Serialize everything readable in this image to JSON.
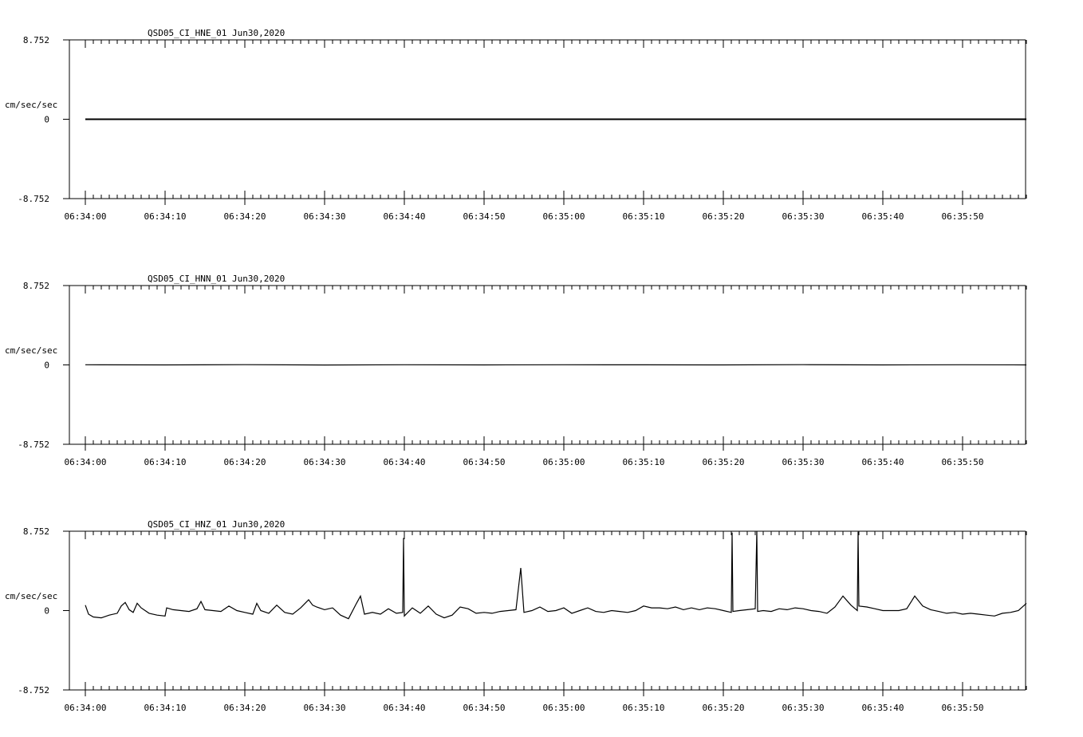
{
  "chart_data": [
    {
      "type": "line",
      "title": "QSD05_CI_HNE_01  Jun30,2020",
      "ylabel": "cm/sec/sec",
      "ylim": [
        -8.752,
        8.752
      ],
      "yticks": [
        "8.752",
        "0",
        "-8.752"
      ],
      "xlim_seconds": [
        0,
        118
      ],
      "xticks": [
        "06:34:00",
        "06:34:10",
        "06:34:20",
        "06:34:30",
        "06:34:40",
        "06:34:50",
        "06:35:00",
        "06:35:10",
        "06:35:20",
        "06:35:30",
        "06:35:40",
        "06:35:50"
      ],
      "series": [
        {
          "values": [
            [
              0,
              0
            ],
            [
              118,
              0
            ]
          ]
        }
      ],
      "grid": false
    },
    {
      "type": "line",
      "title": "QSD05_CI_HNN_01  Jun30,2020",
      "ylabel": "cm/sec/sec",
      "ylim": [
        -8.752,
        8.752
      ],
      "yticks": [
        "8.752",
        "0",
        "-8.752"
      ],
      "xlim_seconds": [
        0,
        118
      ],
      "xticks": [
        "06:34:00",
        "06:34:10",
        "06:34:20",
        "06:34:30",
        "06:34:40",
        "06:34:50",
        "06:35:00",
        "06:35:10",
        "06:35:20",
        "06:35:30",
        "06:35:40",
        "06:35:50"
      ],
      "series": [
        {
          "values": [
            [
              0,
              0.02
            ],
            [
              10,
              0.0
            ],
            [
              20,
              0.03
            ],
            [
              30,
              -0.01
            ],
            [
              40,
              0.02
            ],
            [
              50,
              0.0
            ],
            [
              60,
              0.02
            ],
            [
              70,
              0.01
            ],
            [
              80,
              0.0
            ],
            [
              90,
              0.03
            ],
            [
              100,
              0.0
            ],
            [
              110,
              0.02
            ],
            [
              118,
              0.0
            ]
          ]
        }
      ],
      "grid": false
    },
    {
      "type": "line",
      "title": "QSD05_CI_HNZ_01  Jun30,2020",
      "ylabel": "cm/sec/sec",
      "ylim": [
        -8.752,
        8.752
      ],
      "yticks": [
        "8.752",
        "0",
        "-8.752"
      ],
      "xlim_seconds": [
        0,
        118
      ],
      "xticks": [
        "06:34:00",
        "06:34:10",
        "06:34:20",
        "06:34:30",
        "06:34:40",
        "06:34:50",
        "06:35:00",
        "06:35:10",
        "06:35:20",
        "06:35:30",
        "06:35:40",
        "06:35:50"
      ],
      "series": [
        {
          "values": [
            [
              0,
              0.6
            ],
            [
              0.4,
              -0.4
            ],
            [
              1,
              -0.7
            ],
            [
              2,
              -0.8
            ],
            [
              3,
              -0.5
            ],
            [
              4,
              -0.3
            ],
            [
              4.5,
              0.5
            ],
            [
              5,
              0.9
            ],
            [
              5.5,
              0.1
            ],
            [
              6,
              -0.2
            ],
            [
              6.5,
              0.8
            ],
            [
              7,
              0.3
            ],
            [
              8,
              -0.3
            ],
            [
              9,
              -0.5
            ],
            [
              10,
              -0.6
            ],
            [
              10.2,
              0.3
            ],
            [
              11,
              0.1
            ],
            [
              12,
              0.0
            ],
            [
              13,
              -0.1
            ],
            [
              14,
              0.2
            ],
            [
              14.5,
              1.0
            ],
            [
              15,
              0.1
            ],
            [
              16,
              0.0
            ],
            [
              17,
              -0.1
            ],
            [
              18,
              0.5
            ],
            [
              19,
              0.0
            ],
            [
              20,
              -0.2
            ],
            [
              21,
              -0.4
            ],
            [
              21.5,
              0.8
            ],
            [
              22,
              0.0
            ],
            [
              23,
              -0.3
            ],
            [
              24,
              0.6
            ],
            [
              25,
              -0.2
            ],
            [
              26,
              -0.4
            ],
            [
              27,
              0.3
            ],
            [
              28,
              1.2
            ],
            [
              28.5,
              0.6
            ],
            [
              29,
              0.4
            ],
            [
              30,
              0.1
            ],
            [
              31,
              0.3
            ],
            [
              32,
              -0.5
            ],
            [
              33,
              -0.9
            ],
            [
              34,
              0.8
            ],
            [
              34.5,
              1.6
            ],
            [
              35,
              -0.4
            ],
            [
              36,
              -0.2
            ],
            [
              37,
              -0.4
            ],
            [
              38,
              0.2
            ],
            [
              39,
              -0.3
            ],
            [
              39.8,
              -0.2
            ],
            [
              39.9,
              8.0
            ],
            [
              40,
              -0.6
            ],
            [
              41,
              0.3
            ],
            [
              42,
              -0.3
            ],
            [
              43,
              0.5
            ],
            [
              44,
              -0.4
            ],
            [
              45,
              -0.8
            ],
            [
              46,
              -0.5
            ],
            [
              47,
              0.4
            ],
            [
              48,
              0.2
            ],
            [
              49,
              -0.3
            ],
            [
              50,
              -0.2
            ],
            [
              51,
              -0.3
            ],
            [
              52,
              -0.1
            ],
            [
              54,
              0.1
            ],
            [
              54.6,
              4.7
            ],
            [
              55,
              -0.2
            ],
            [
              56,
              0.0
            ],
            [
              57,
              0.4
            ],
            [
              58,
              -0.1
            ],
            [
              59,
              0.0
            ],
            [
              60,
              0.3
            ],
            [
              61,
              -0.3
            ],
            [
              62,
              0.0
            ],
            [
              63,
              0.3
            ],
            [
              64,
              -0.1
            ],
            [
              65,
              -0.2
            ],
            [
              66,
              0.0
            ],
            [
              67,
              -0.1
            ],
            [
              68,
              -0.2
            ],
            [
              69,
              0.0
            ],
            [
              70,
              0.5
            ],
            [
              71,
              0.3
            ],
            [
              72,
              0.3
            ],
            [
              73,
              0.2
            ],
            [
              74,
              0.4
            ],
            [
              75,
              0.1
            ],
            [
              76,
              0.3
            ],
            [
              77,
              0.1
            ],
            [
              78,
              0.3
            ],
            [
              79,
              0.2
            ],
            [
              80,
              0.0
            ],
            [
              81,
              -0.2
            ],
            [
              81.1,
              8.6
            ],
            [
              81.2,
              -0.1
            ],
            [
              82,
              0.0
            ],
            [
              83,
              0.1
            ],
            [
              84,
              0.2
            ],
            [
              84.2,
              8.8
            ],
            [
              84.3,
              -0.1
            ],
            [
              85,
              0.0
            ],
            [
              86,
              -0.1
            ],
            [
              87,
              0.2
            ],
            [
              88,
              0.1
            ],
            [
              89,
              0.3
            ],
            [
              90,
              0.2
            ],
            [
              91,
              0.0
            ],
            [
              92,
              -0.1
            ],
            [
              93,
              -0.3
            ],
            [
              94,
              0.4
            ],
            [
              95,
              1.6
            ],
            [
              96,
              0.6
            ],
            [
              96.8,
              0.0
            ],
            [
              96.9,
              8.7
            ],
            [
              97,
              0.5
            ],
            [
              98,
              0.4
            ],
            [
              99,
              0.2
            ],
            [
              100,
              0.0
            ],
            [
              101,
              0.0
            ],
            [
              102,
              0.0
            ],
            [
              103,
              0.2
            ],
            [
              104,
              1.6
            ],
            [
              105,
              0.5
            ],
            [
              106,
              0.1
            ],
            [
              107,
              -0.1
            ],
            [
              108,
              -0.3
            ],
            [
              109,
              -0.2
            ],
            [
              110,
              -0.4
            ],
            [
              111,
              -0.3
            ],
            [
              112,
              -0.4
            ],
            [
              113,
              -0.5
            ],
            [
              114,
              -0.6
            ],
            [
              115,
              -0.3
            ],
            [
              116,
              -0.2
            ],
            [
              117,
              0.0
            ],
            [
              118,
              0.8
            ]
          ]
        }
      ],
      "grid": false
    }
  ]
}
